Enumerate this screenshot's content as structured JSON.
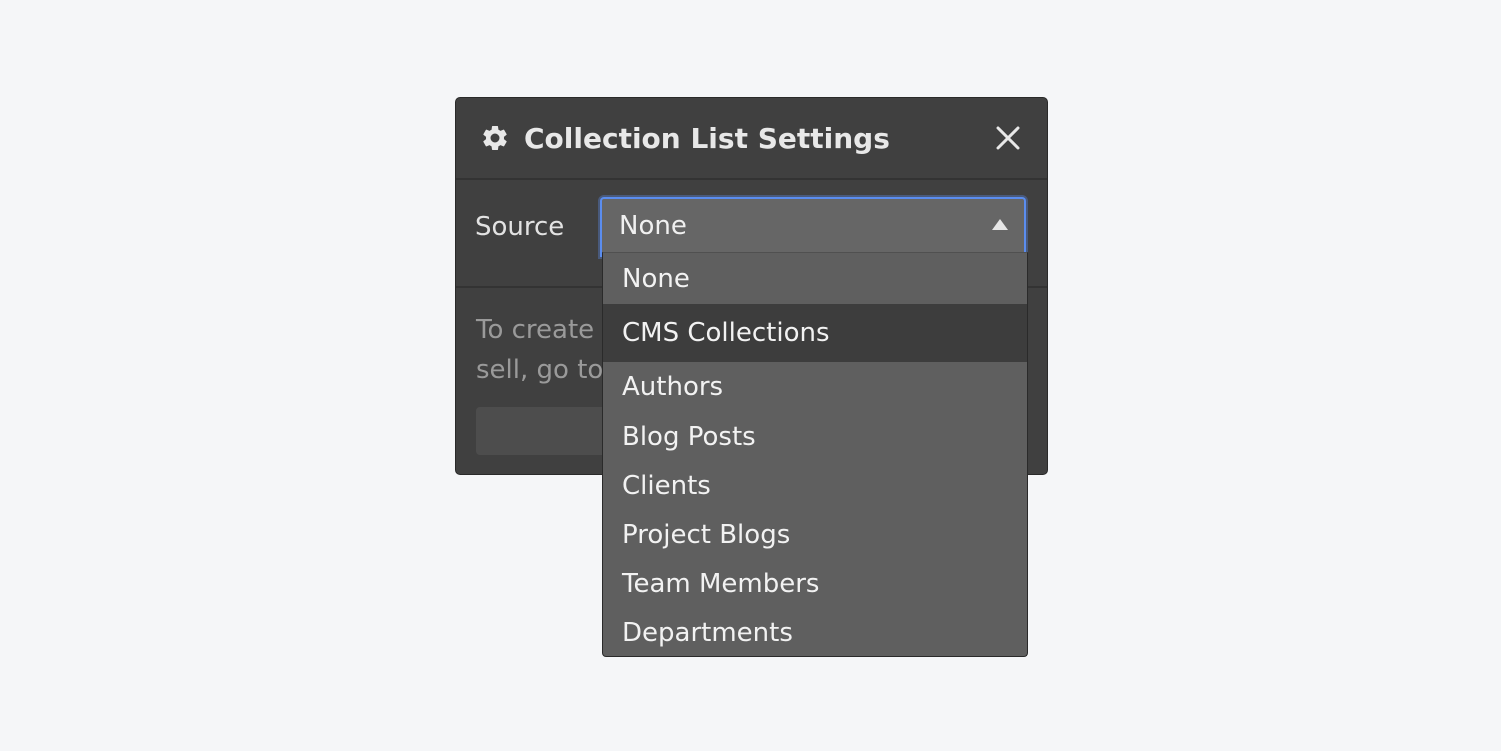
{
  "panel": {
    "title": "Collection List Settings",
    "icon": "gear-icon",
    "close_icon": "close-icon"
  },
  "source": {
    "label": "Source",
    "selected": "None"
  },
  "help_text": {
    "line1": "To create",
    "line2": "sell, go to"
  },
  "dropdown": {
    "top_option": "None",
    "group_header": "CMS Collections",
    "items": [
      "Authors",
      "Blog Posts",
      "Clients",
      "Project Blogs",
      "Team Members",
      "Departments"
    ]
  },
  "colors": {
    "background": "#f5f6f8",
    "panel": "#404040",
    "dropdown": "#5f5f5f",
    "group_header": "#3d3d3d",
    "focus_border": "#5b8def"
  }
}
